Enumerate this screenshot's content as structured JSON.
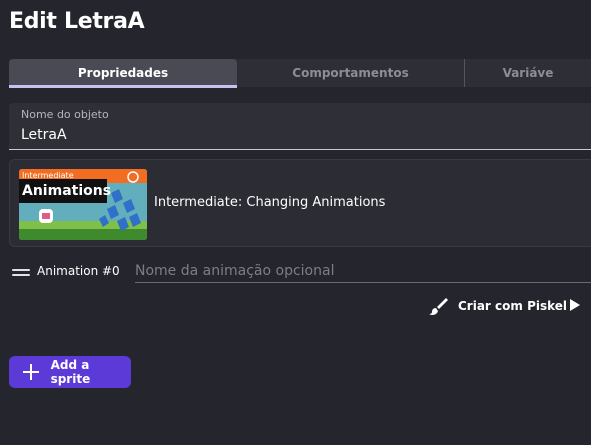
{
  "header": {
    "title": "Edit LetraA"
  },
  "tabs": [
    {
      "label": "Propriedades",
      "active": true
    },
    {
      "label": "Comportamentos",
      "active": false
    },
    {
      "label": "Variáve",
      "active": false
    }
  ],
  "object_name_field": {
    "label": "Nome do objeto",
    "value": "LetraA"
  },
  "tutorial": {
    "thumbnail_text_top": "Intermediate",
    "thumbnail_text_main": "Animations",
    "title": "Intermediate: Changing Animations"
  },
  "animation": {
    "label": "Animation #0",
    "name_value": "",
    "name_placeholder": "Nome da animação opcional"
  },
  "piskel": {
    "label": "Criar com Piskel"
  },
  "add_sprite": {
    "label": "Add a sprite"
  },
  "colors": {
    "background": "#25252e",
    "accent": "#5b3ad8",
    "tab_indicator": "#c6c2f0"
  }
}
